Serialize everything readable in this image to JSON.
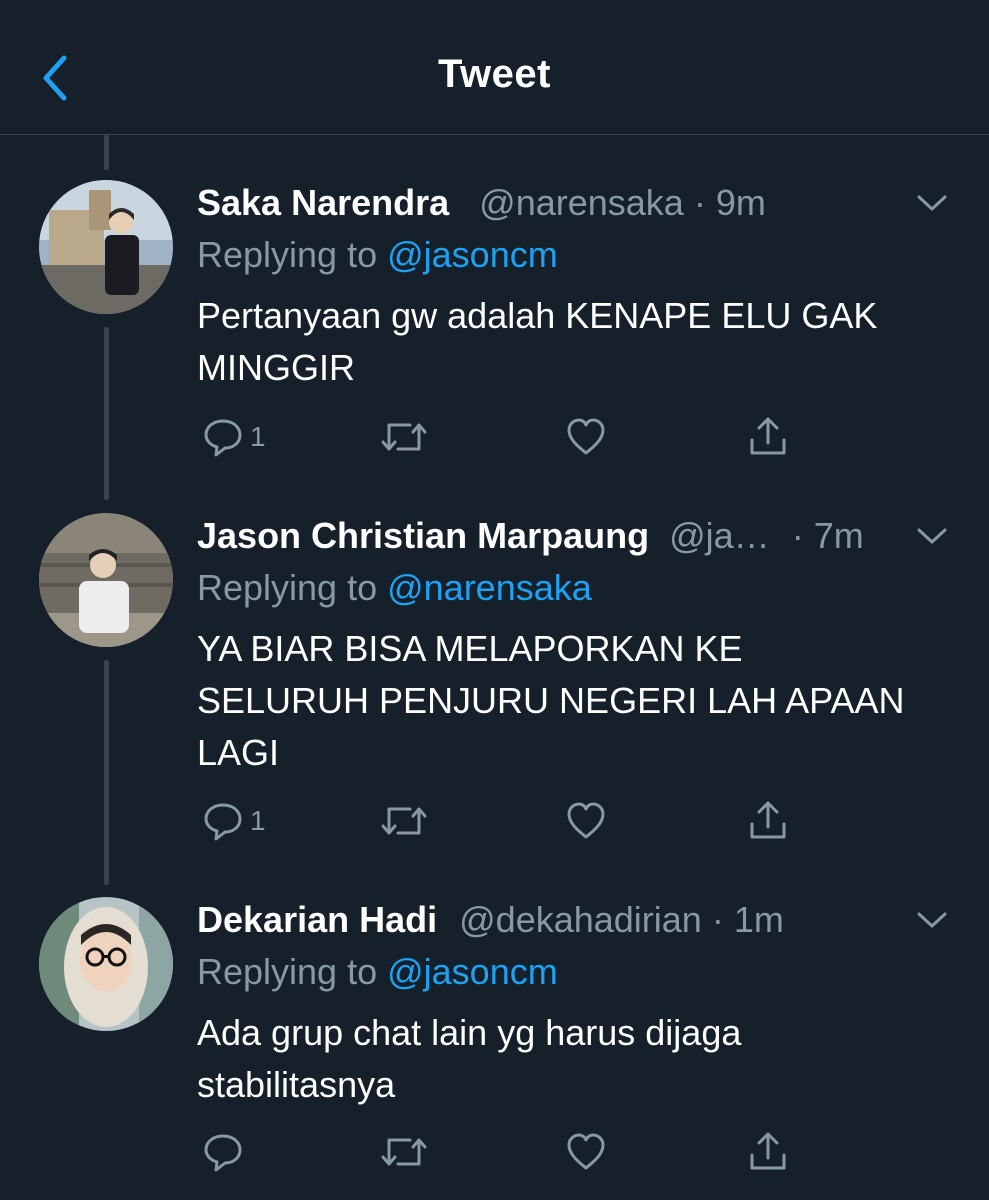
{
  "header": {
    "title": "Tweet",
    "back_icon": "chevron-left-icon"
  },
  "colors": {
    "background": "#15202b",
    "accent": "#1da1f2",
    "muted": "#8899a6",
    "divider": "#38444d"
  },
  "tweets": [
    {
      "name": "Saka Narendra",
      "handle": "@narensaka",
      "dot": "·",
      "time": "9m",
      "replying_prefix": "Replying to ",
      "replying_to": "@jasoncm",
      "text_lines": [
        "Pertanyaan gw adalah KENAPE ELU GAK",
        "MINGGIR"
      ],
      "reply_count": "1"
    },
    {
      "name": "Jason Christian Marpaung",
      "handle": "@ja…",
      "dot": "·",
      "time": "7m",
      "replying_prefix": "Replying to ",
      "replying_to": "@narensaka",
      "text_lines": [
        "YA BIAR BISA MELAPORKAN KE",
        "SELURUH PENJURU NEGERI LAH APAAN",
        "LAGI"
      ],
      "reply_count": "1"
    },
    {
      "name": "Dekarian Hadi",
      "handle": "@dekahadirian",
      "dot": "·",
      "time": "1m",
      "replying_prefix": "Replying to ",
      "replying_to": "@jasoncm",
      "text_lines": [
        "Ada grup chat lain yg harus dijaga",
        "stabilitasnya"
      ],
      "reply_count": ""
    }
  ]
}
